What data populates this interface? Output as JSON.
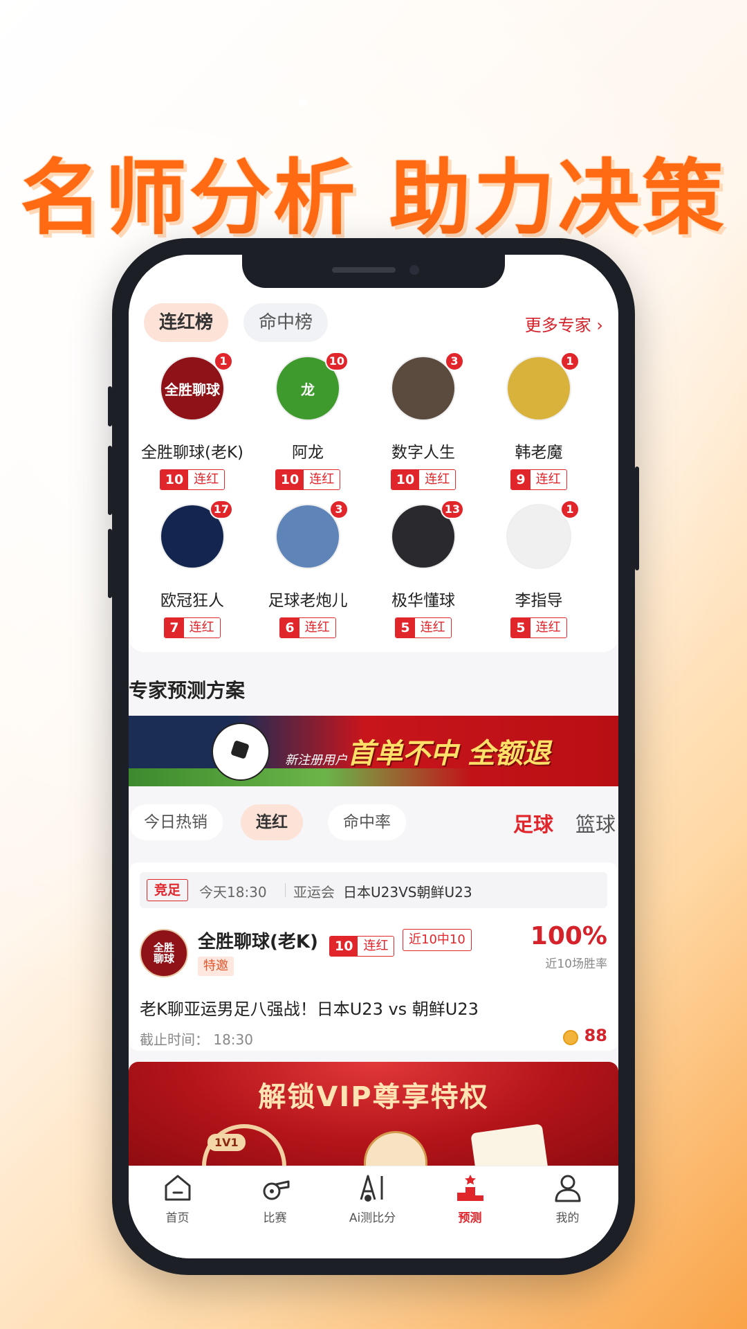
{
  "headline": "名师分析 助力决策",
  "tabs": {
    "active": "连红榜",
    "inactive": "命中榜",
    "more": "更多专家 ›"
  },
  "experts": [
    {
      "name": "全胜聊球(老K)",
      "badge": "1",
      "streak": "10",
      "streak_label": "连红",
      "avatar_text": "全胜聊球",
      "color": "#8e1218"
    },
    {
      "name": "阿龙",
      "badge": "10",
      "streak": "10",
      "streak_label": "连红",
      "avatar_text": "龙",
      "color": "#3f9a2e"
    },
    {
      "name": "数字人生",
      "badge": "3",
      "streak": "10",
      "streak_label": "连红",
      "avatar_text": "",
      "color": "#5b4a3e"
    },
    {
      "name": "韩老魔",
      "badge": "1",
      "streak": "9",
      "streak_label": "连红",
      "avatar_text": "",
      "color": "#d8b23a"
    },
    {
      "name": "欧冠狂人",
      "badge": "17",
      "streak": "7",
      "streak_label": "连红",
      "avatar_text": "",
      "color": "#14264f"
    },
    {
      "name": "足球老炮儿",
      "badge": "3",
      "streak": "6",
      "streak_label": "连红",
      "avatar_text": "",
      "color": "#5f84b8"
    },
    {
      "name": "极华懂球",
      "badge": "13",
      "streak": "5",
      "streak_label": "连红",
      "avatar_text": "",
      "color": "#2a2a2e"
    },
    {
      "name": "李指导",
      "badge": "1",
      "streak": "5",
      "streak_label": "连红",
      "avatar_text": "",
      "color": "#f0f0f0"
    }
  ],
  "section_title": "专家预测方案",
  "banner": {
    "sub": "新注册用户",
    "main": "首单不中 全额退"
  },
  "filters": [
    "今日热销",
    "连红",
    "命中率"
  ],
  "sports": [
    "足球",
    "篮球"
  ],
  "plan": {
    "tag": "竞足",
    "time": "今天18:30",
    "league": "亚运会",
    "match": "日本U23VS朝鲜U23",
    "avatar_text": "全胜\n聊球",
    "expert": "全胜聊球(老K)",
    "streak": "10",
    "streak_label": "连红",
    "record": "近10中10",
    "special": "特邀",
    "rate": "100%",
    "rate_label": "近10场胜率",
    "title": "老K聊亚运男足八强战！日本U23 vs 朝鲜U23",
    "deadline": "截止时间： 18:30",
    "price": "88"
  },
  "vip": {
    "title": "解锁VIP尊享特权",
    "tag": "1V1"
  },
  "tabbar": [
    {
      "label": "首页",
      "icon": "home-icon"
    },
    {
      "label": "比赛",
      "icon": "whistle-icon"
    },
    {
      "label": "Ai测比分",
      "icon": "ai-icon"
    },
    {
      "label": "预测",
      "icon": "podium-icon",
      "active": true
    },
    {
      "label": "我的",
      "icon": "user-icon"
    }
  ],
  "colors": {
    "accent": "#e0252b",
    "headline": "#ff6a13"
  }
}
